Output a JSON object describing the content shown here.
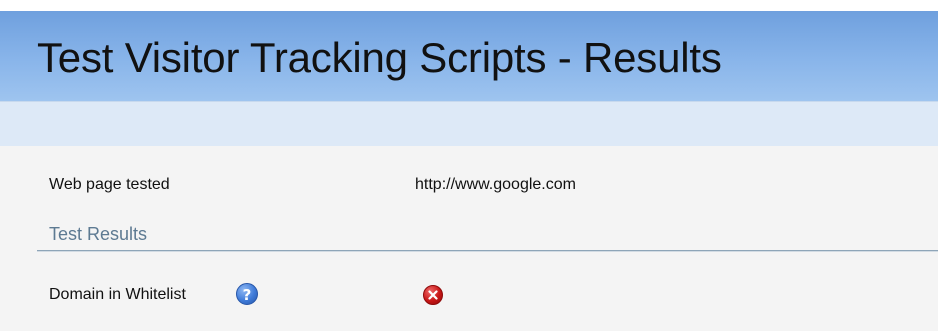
{
  "header": {
    "title": "Test Visitor Tracking Scripts - Results"
  },
  "details": {
    "web_page_label": "Web page tested",
    "web_page_value": "http://www.google.com"
  },
  "test_results": {
    "section_title": "Test Results",
    "items": [
      {
        "label": "Domain in Whitelist",
        "help_icon": "question-circle-icon",
        "status_icon": "error-x-icon",
        "status": "fail"
      }
    ]
  },
  "colors": {
    "header_blue": "#7eaee6",
    "subbar": "#dde9f7",
    "section_title": "#5d7a92",
    "error_red": "#c81616",
    "help_blue": "#3f7bd9"
  }
}
